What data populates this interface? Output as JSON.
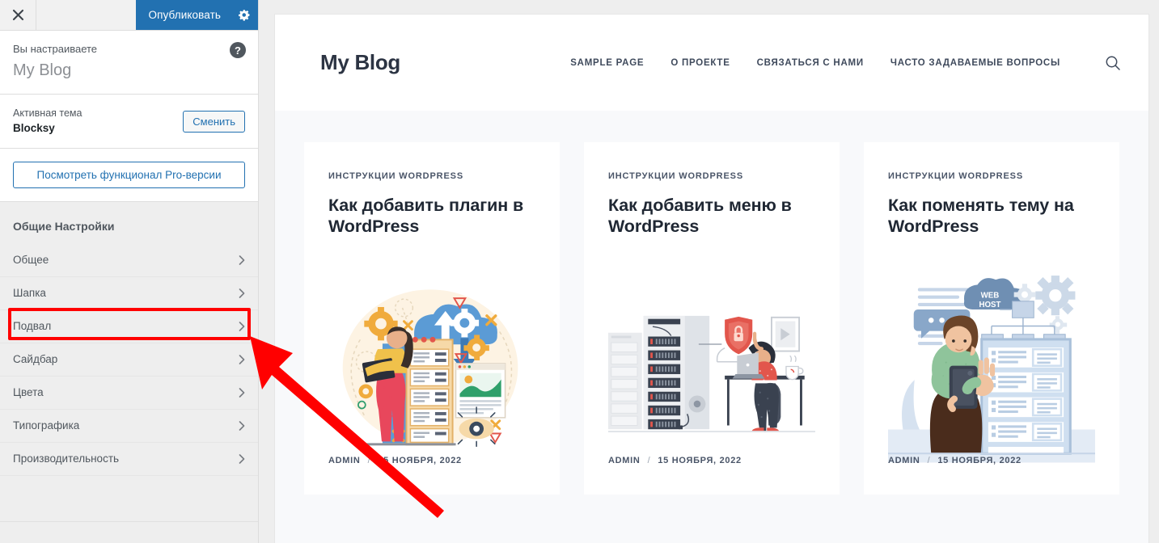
{
  "customizer": {
    "topbar": {
      "close_icon": "close-x-icon",
      "publish_label": "Опубликовать",
      "gear_icon": "gear-icon"
    },
    "info": {
      "you_are_customizing_label": "Вы настраиваете",
      "site_title": "My Blog",
      "help_icon": "question-mark-icon",
      "help_label": "?"
    },
    "theme": {
      "active_theme_label": "Активная тема",
      "theme_name": "Blocksy",
      "change_button_label": "Сменить"
    },
    "pro_button_label": "Посмотреть функционал Pro-версии",
    "group_title": "Общие Настройки",
    "menu_items": [
      {
        "label": "Общее",
        "highlighted": false
      },
      {
        "label": "Шапка",
        "highlighted": true
      },
      {
        "label": "Подвал",
        "highlighted": false
      },
      {
        "label": "Сайдбар",
        "highlighted": false
      },
      {
        "label": "Цвета",
        "highlighted": false
      },
      {
        "label": "Типографика",
        "highlighted": false
      },
      {
        "label": "Производительность",
        "highlighted": false
      }
    ]
  },
  "preview": {
    "site_logo": "My Blog",
    "nav_links": [
      "SAMPLE PAGE",
      "О ПРОЕКТЕ",
      "СВЯЗАТЬСЯ С НАМИ",
      "ЧАСТО ЗАДАВАЕМЫЕ ВОПРОСЫ"
    ],
    "search_icon": "search-icon",
    "posts": [
      {
        "category": "ИНСТРУКЦИИ WORDPRESS",
        "title": "Как добавить плагин в WordPress",
        "author": "ADMIN",
        "separator": "/",
        "date": "15 НОЯБРЯ, 2022",
        "illustration": "cloud-server-woman-laptop-illustration"
      },
      {
        "category": "ИНСТРУКЦИИ WORDPRESS",
        "title": "Как добавить меню в WordPress",
        "author": "ADMIN",
        "separator": "/",
        "date": "15 НОЯБРЯ, 2022",
        "illustration": "server-rack-security-shield-man-desk-illustration"
      },
      {
        "category": "ИНСТРУКЦИИ WORDPRESS",
        "title": "Как поменять тему на WordPress",
        "author": "ADMIN",
        "separator": "/",
        "date": "15 НОЯБРЯ, 2022",
        "illustration": "web-host-woman-tablet-server-illustration",
        "cloud_label_line1": "WEB",
        "cloud_label_line2": "HOST"
      }
    ]
  },
  "annotation": {
    "color": "#ff0000",
    "highlight_target": "Шапка",
    "arrow_name": "red-pointer-arrow"
  },
  "colors": {
    "wp_blue": "#2271b1",
    "sidebar_bg": "#eeeeee",
    "preview_bg": "#f8f9fb",
    "annotation_red": "#ff0000",
    "heading_dark": "#1f2733"
  }
}
